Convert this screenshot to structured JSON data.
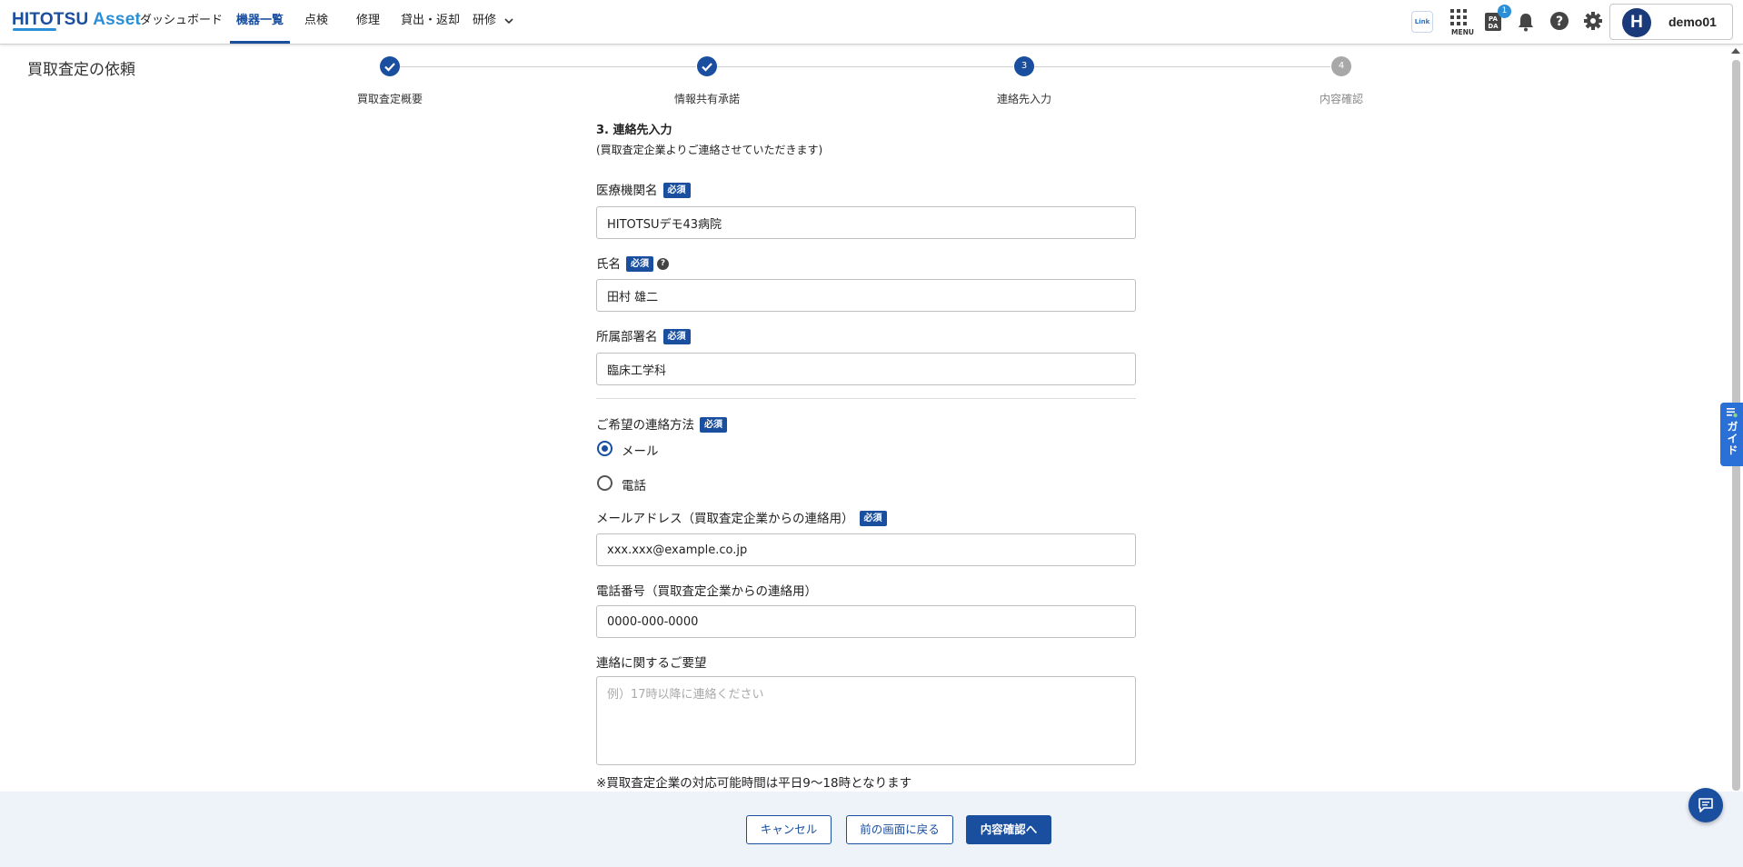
{
  "header": {
    "logo_main": "HITOTSU",
    "logo_accent": "Asset",
    "nav": [
      {
        "label": "ダッシュボード"
      },
      {
        "label": "機器一覧"
      },
      {
        "label": "点検"
      },
      {
        "label": "修理"
      },
      {
        "label": "貸出・返却"
      },
      {
        "label": "研修"
      }
    ],
    "link_icon_text": "Link",
    "menu_label": "MENU",
    "pada_badge": "1",
    "user_initial": "H",
    "user_name": "demo01"
  },
  "page": {
    "title": "買取査定の依頼"
  },
  "stepper": {
    "steps": [
      {
        "label": "買取査定概要",
        "status": "done"
      },
      {
        "label": "情報共有承諾",
        "status": "done"
      },
      {
        "number": "3",
        "label": "連絡先入力",
        "status": "current"
      },
      {
        "number": "4",
        "label": "内容確認",
        "status": "pending"
      }
    ]
  },
  "form": {
    "section_title": "3. 連絡先入力",
    "section_sub": "(買取査定企業よりご連絡させていただきます)",
    "required_badge": "必須",
    "institution": {
      "label": "医療機関名",
      "value": "HITOTSUデモ43病院"
    },
    "name": {
      "label": "氏名",
      "value": "田村 雄二"
    },
    "department": {
      "label": "所属部署名",
      "value": "臨床工学科"
    },
    "contact_method": {
      "label": "ご希望の連絡方法",
      "options": [
        {
          "label": "メール",
          "checked": true
        },
        {
          "label": "電話",
          "checked": false
        }
      ]
    },
    "email": {
      "label": "メールアドレス（買取査定企業からの連絡用）",
      "value": "xxx.xxx@example.co.jp"
    },
    "phone": {
      "label": "電話番号（買取査定企業からの連絡用）",
      "value": "0000-000-0000"
    },
    "request": {
      "label": "連絡に関するご要望",
      "placeholder": "例）17時以降に連絡ください"
    },
    "note": "※買取査定企業の対応可能時間は平日9〜18時となります"
  },
  "footer": {
    "cancel": "キャンセル",
    "back": "前の画面に戻る",
    "next": "内容確認へ"
  },
  "side": {
    "guide": "ガイド"
  },
  "colors": {
    "primary": "#1a4fa0",
    "accent": "#2a8fd6",
    "footer_bg": "#eef2f9"
  }
}
